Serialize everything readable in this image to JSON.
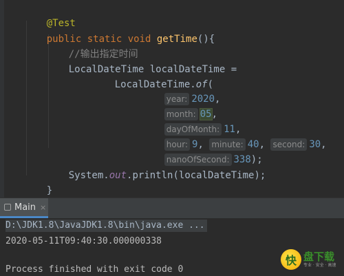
{
  "editor": {
    "annotation": "@Test",
    "method": {
      "modifiers": "public static void ",
      "name": "getTime",
      "signature_tail": "(){"
    },
    "comment": "//输出指定时间",
    "declaration": "LocalDateTime localDateTime =",
    "call": {
      "class_name": "LocalDateTime.",
      "method": "of",
      "open_paren": "("
    },
    "args": {
      "year": {
        "hint": "year:",
        "value": "2020",
        "sep": ","
      },
      "month": {
        "hint": "month:",
        "value": "05",
        "sep": ","
      },
      "day_of_month": {
        "hint": "dayOfMonth:",
        "value": "11",
        "sep": ","
      },
      "hour": {
        "hint": "hour:",
        "value": "9",
        "sep": ","
      },
      "minute": {
        "hint": "minute:",
        "value": "40",
        "sep": ","
      },
      "second": {
        "hint": "second:",
        "value": "30",
        "sep": ","
      },
      "nano": {
        "hint": "nanoOfSecond:",
        "value": "338",
        "sep": ");"
      }
    },
    "print": {
      "prefix": "System.",
      "field": "out",
      "method": ".println(localDateTime);"
    },
    "closing_brace": "}"
  },
  "run_panel": {
    "tab_label": "Main",
    "tab_close": "×",
    "command": "D:\\JDK1.8\\JavaJDK1.8\\bin\\java.exe ...",
    "output": "2020-05-11T09:40:30.000000338",
    "exit_message": "Process finished with exit code 0"
  },
  "watermark": {
    "mark_char": "快",
    "main_text": "盘下载",
    "sub_text": "专业 · 安全 · 高速"
  },
  "colors": {
    "editor_bg": "#2b2b2b",
    "keyword": "#cc7832",
    "method_name": "#ffc66d",
    "annotation": "#bbb529",
    "number": "#6897bb",
    "comment": "#808080",
    "static_field": "#9876aa",
    "tab_accent": "#4a88c7"
  }
}
